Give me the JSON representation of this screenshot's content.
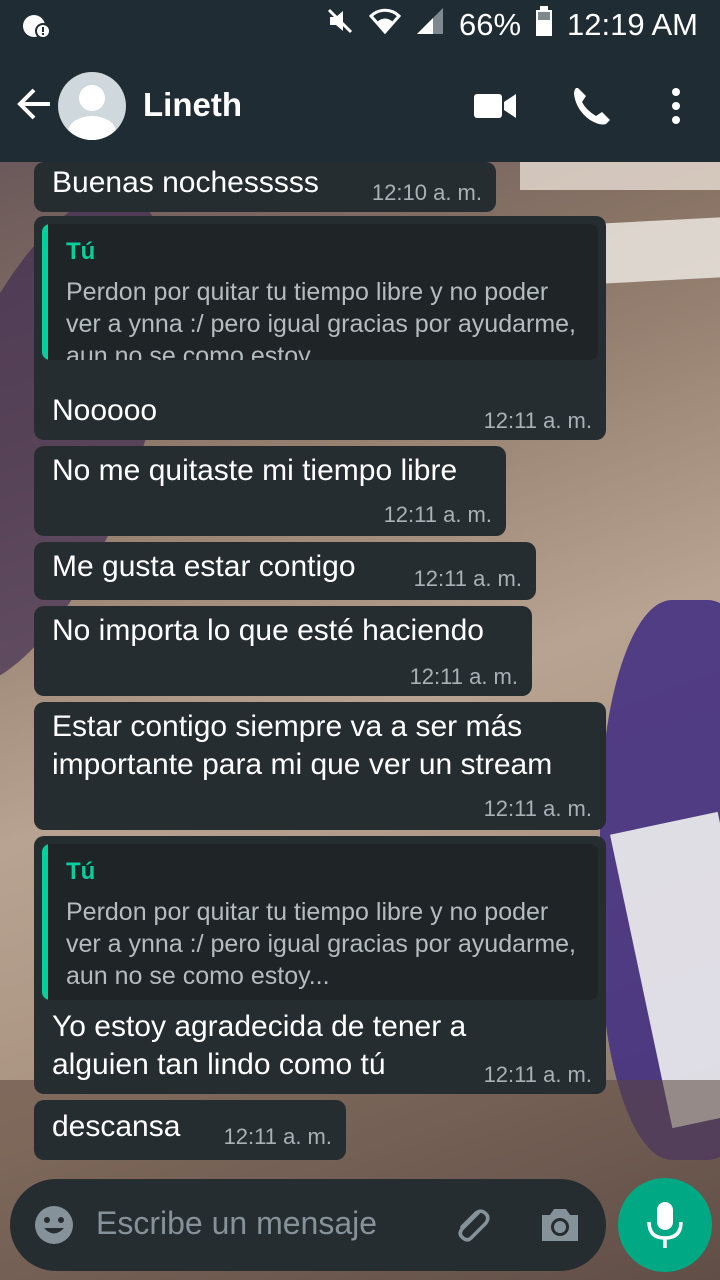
{
  "status_bar": {
    "battery": "66%",
    "time": "12:19 AM"
  },
  "header": {
    "contact_name": "Lineth"
  },
  "messages": [
    {
      "text": "Buenas nochesssss",
      "time": "12:10 a. m."
    },
    {
      "quote_author": "Tú",
      "quote_text": "Perdon por quitar tu tiempo libre y no poder ver a ynna :/ pero igual gracias por ayudarme, aun no se como estoy...",
      "text": "Nooooo",
      "time": "12:11 a. m."
    },
    {
      "text": "No me quitaste mi tiempo libre",
      "time": "12:11 a. m."
    },
    {
      "text": "Me gusta estar contigo",
      "time": "12:11 a. m."
    },
    {
      "text": "No importa lo que esté haciendo",
      "time": "12:11 a. m."
    },
    {
      "text": "Estar contigo siempre va a ser más importante para mi que ver un stream",
      "time": "12:11 a. m."
    },
    {
      "quote_author": "Tú",
      "quote_text": "Perdon por quitar tu tiempo libre y no poder ver a ynna :/ pero igual gracias por ayudarme, aun no se como estoy...",
      "text": "Yo estoy agradecida de tener a alguien tan lindo como tú",
      "time": "12:11 a. m."
    },
    {
      "text": "descansa",
      "time": "12:11 a. m."
    }
  ],
  "input": {
    "placeholder": "Escribe un mensaje"
  },
  "colors": {
    "header_bg": "#1f2c33",
    "bubble_bg": "#262d31",
    "quote_accent": "#06cf9c",
    "mic_button": "#00a884"
  },
  "icons": [
    "notification-icon",
    "mute-icon",
    "wifi-icon",
    "signal-icon",
    "battery-icon",
    "back-arrow-icon",
    "video-call-icon",
    "phone-icon",
    "more-vert-icon",
    "emoji-icon",
    "attach-icon",
    "camera-icon",
    "mic-icon"
  ]
}
